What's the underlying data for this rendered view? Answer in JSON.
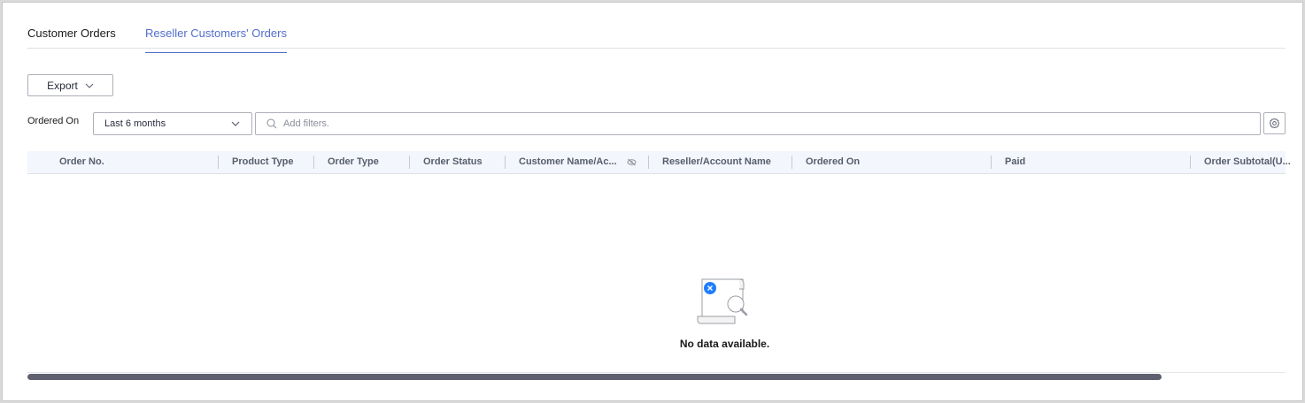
{
  "tabs": [
    {
      "label": "Customer Orders",
      "active": false
    },
    {
      "label": "Reseller Customers' Orders",
      "active": true
    }
  ],
  "toolbar": {
    "export_label": "Export"
  },
  "filters": {
    "ordered_on_label": "Ordered On",
    "ordered_on_value": "Last 6 months",
    "search_placeholder": "Add filters."
  },
  "table": {
    "columns": [
      "Order No.",
      "Product Type",
      "Order Type",
      "Order Status",
      "Customer Name/Ac...",
      "Reseller/Account Name",
      "Ordered On",
      "Paid",
      "Order Subtotal(U..."
    ]
  },
  "empty": {
    "message": "No data available."
  },
  "colors": {
    "accent": "#526ecc",
    "header_bg": "#f3f6fc",
    "scrollbar": "#5f6170"
  }
}
